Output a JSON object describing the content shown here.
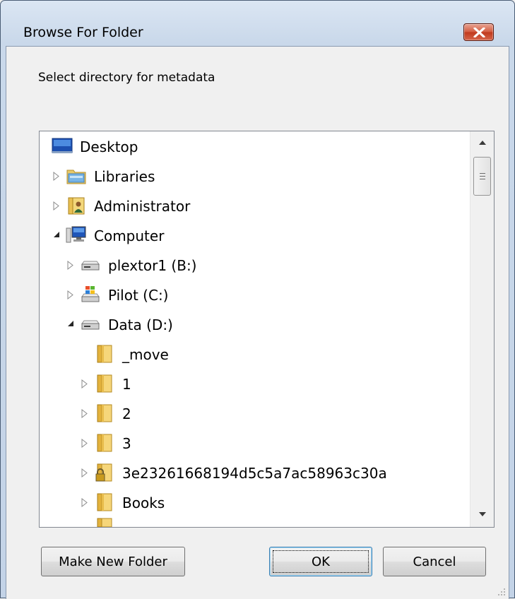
{
  "window": {
    "title": "Browse For Folder"
  },
  "prompt": "Select directory for metadata",
  "tree": {
    "items": [
      {
        "label": "Desktop",
        "icon": "desktop-icon",
        "expander": "none",
        "level": 0
      },
      {
        "label": "Libraries",
        "icon": "libraries-icon",
        "expander": "collapsed",
        "level": 0
      },
      {
        "label": "Administrator",
        "icon": "user-folder-icon",
        "expander": "collapsed",
        "level": 0
      },
      {
        "label": "Computer",
        "icon": "computer-icon",
        "expander": "expanded",
        "level": 0
      },
      {
        "label": "plextor1 (B:)",
        "icon": "drive-icon",
        "expander": "collapsed",
        "level": 1
      },
      {
        "label": "Pilot (C:)",
        "icon": "system-drive-icon",
        "expander": "collapsed",
        "level": 1
      },
      {
        "label": "Data (D:)",
        "icon": "drive-icon",
        "expander": "expanded",
        "level": 1
      },
      {
        "label": "_move",
        "icon": "folder-icon",
        "expander": "none",
        "level": 2
      },
      {
        "label": "1",
        "icon": "folder-icon",
        "expander": "collapsed",
        "level": 2
      },
      {
        "label": "2",
        "icon": "folder-icon",
        "expander": "collapsed",
        "level": 2
      },
      {
        "label": "3",
        "icon": "folder-icon",
        "expander": "collapsed",
        "level": 2
      },
      {
        "label": "3e23261668194d5c5a7ac58963c30a",
        "icon": "locked-folder-icon",
        "expander": "collapsed",
        "level": 2
      },
      {
        "label": "Books",
        "icon": "folder-icon",
        "expander": "collapsed",
        "level": 2
      }
    ]
  },
  "buttons": {
    "make_new_folder": "Make New Folder",
    "ok": "OK",
    "cancel": "Cancel"
  }
}
